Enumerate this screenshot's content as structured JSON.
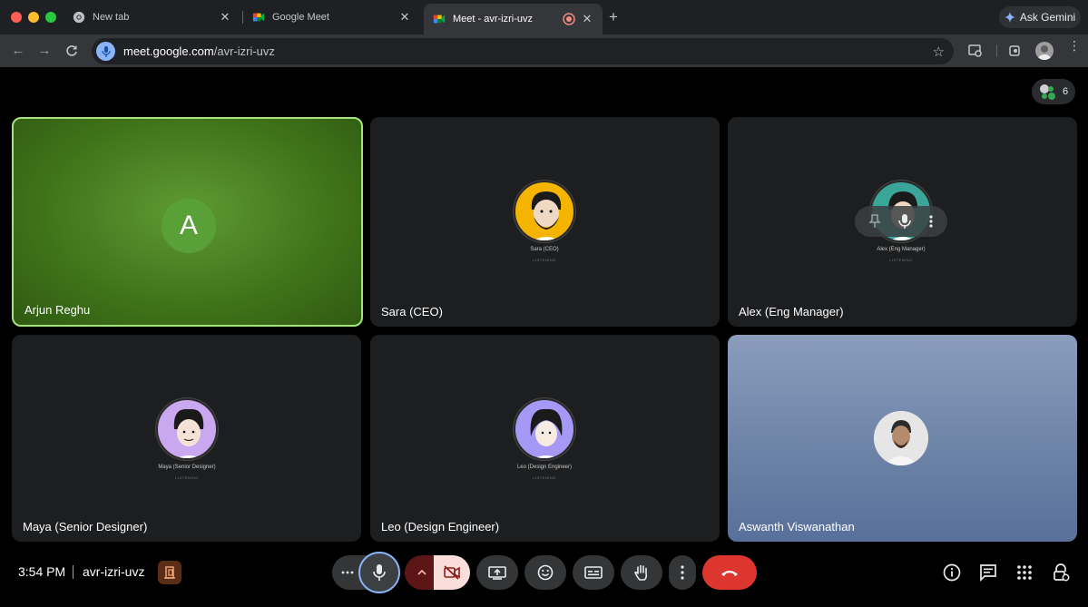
{
  "browser": {
    "tabs": [
      {
        "title": "New tab",
        "icon": "chrome-icon"
      },
      {
        "title": "Google Meet",
        "icon": "google-meet-icon"
      },
      {
        "title": "Meet - avr-izri-uvz",
        "icon": "google-meet-icon",
        "recording": true,
        "active": true
      }
    ],
    "new_tab_label": "+",
    "gemini_label": "Ask Gemini",
    "url_host": "meet.google.com",
    "url_path": "/avr-izri-uvz"
  },
  "meet": {
    "participant_count": "6",
    "tiles": [
      {
        "name": "Arjun Reghu",
        "avatar_letter": "A",
        "speaking": true
      },
      {
        "name": "Sara (CEO)",
        "mini_name": "Sara (CEO)",
        "mini_status": "LISTENING"
      },
      {
        "name": "Alex (Eng Manager)",
        "mini_name": "Alex (Eng Manager)",
        "mini_status": "LISTENING"
      },
      {
        "name": "Maya (Senior Designer)",
        "mini_name": "Maya (Senior Designer)",
        "mini_status": "LISTENING"
      },
      {
        "name": "Leo (Design Engineer)",
        "mini_name": "Leo (Design Engineer)",
        "mini_status": "LISTENING"
      },
      {
        "name": "Aswanth Viswanathan"
      }
    ],
    "footer": {
      "time": "3:54 PM",
      "meeting_code": "avr-izri-uvz"
    }
  },
  "colors": {
    "speaking_border": "#a4e37d",
    "end_call": "#dc362e",
    "camera_off_bg": "#f9dedc"
  }
}
